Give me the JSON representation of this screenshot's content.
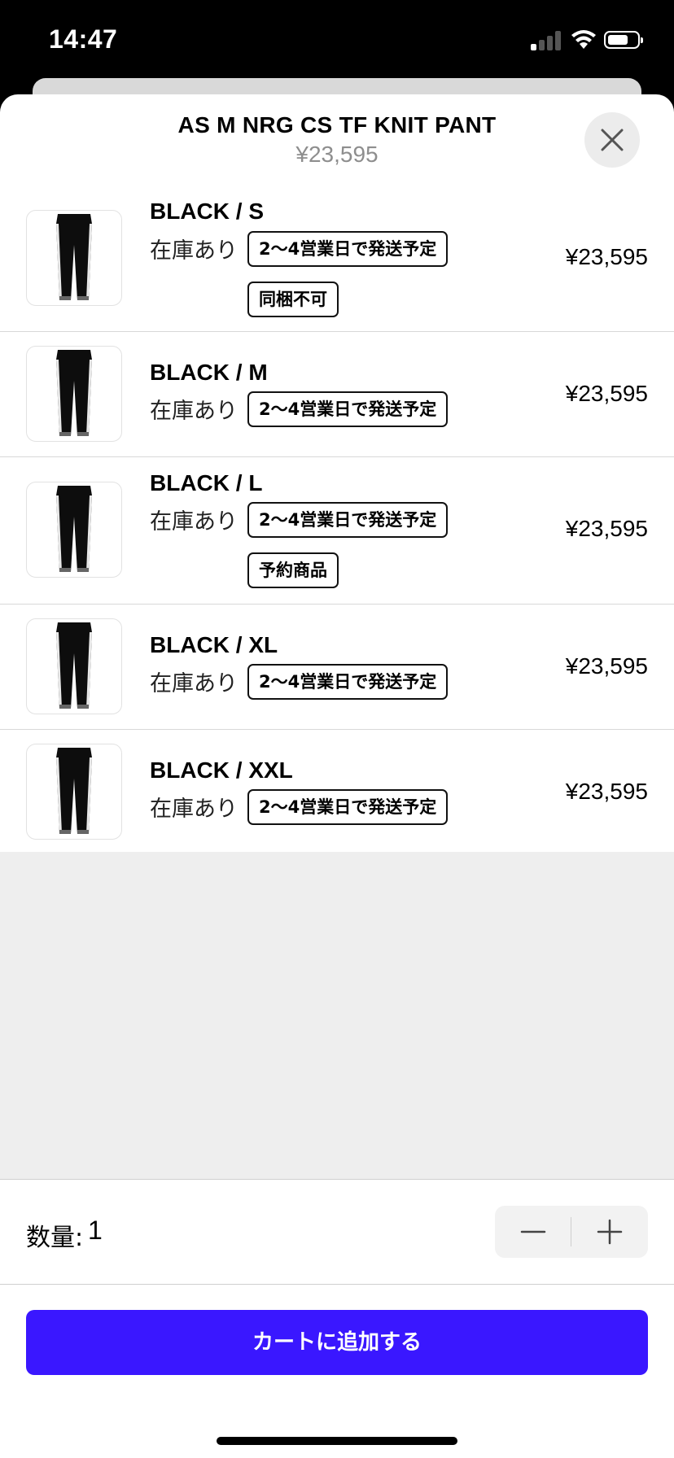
{
  "status_bar": {
    "time": "14:47"
  },
  "product": {
    "title": "AS M NRG CS TF KNIT PANT",
    "price": "¥23,595"
  },
  "variants": [
    {
      "name": "BLACK / S",
      "stock": "在庫あり",
      "tags": [
        "2～4営業日で発送予定",
        "同梱不可"
      ],
      "price": "¥23,595"
    },
    {
      "name": "BLACK / M",
      "stock": "在庫あり",
      "tags": [
        "2～4営業日で発送予定"
      ],
      "price": "¥23,595"
    },
    {
      "name": "BLACK / L",
      "stock": "在庫あり",
      "tags": [
        "2～4営業日で発送予定",
        "予約商品"
      ],
      "price": "¥23,595"
    },
    {
      "name": "BLACK / XL",
      "stock": "在庫あり",
      "tags": [
        "2～4営業日で発送予定"
      ],
      "price": "¥23,595"
    },
    {
      "name": "BLACK / XXL",
      "stock": "在庫あり",
      "tags": [
        "2～4営業日で発送予定"
      ],
      "price": "¥23,595"
    }
  ],
  "quantity": {
    "label": "数量:",
    "value": "1"
  },
  "cart_button": {
    "label": "カートに追加する"
  },
  "colors": {
    "accent": "#3a17ff",
    "empty_background": "#eeeeee"
  },
  "icons": [
    "signal-icon",
    "wifi-icon",
    "battery-icon",
    "close-icon",
    "minus-icon",
    "plus-icon"
  ]
}
